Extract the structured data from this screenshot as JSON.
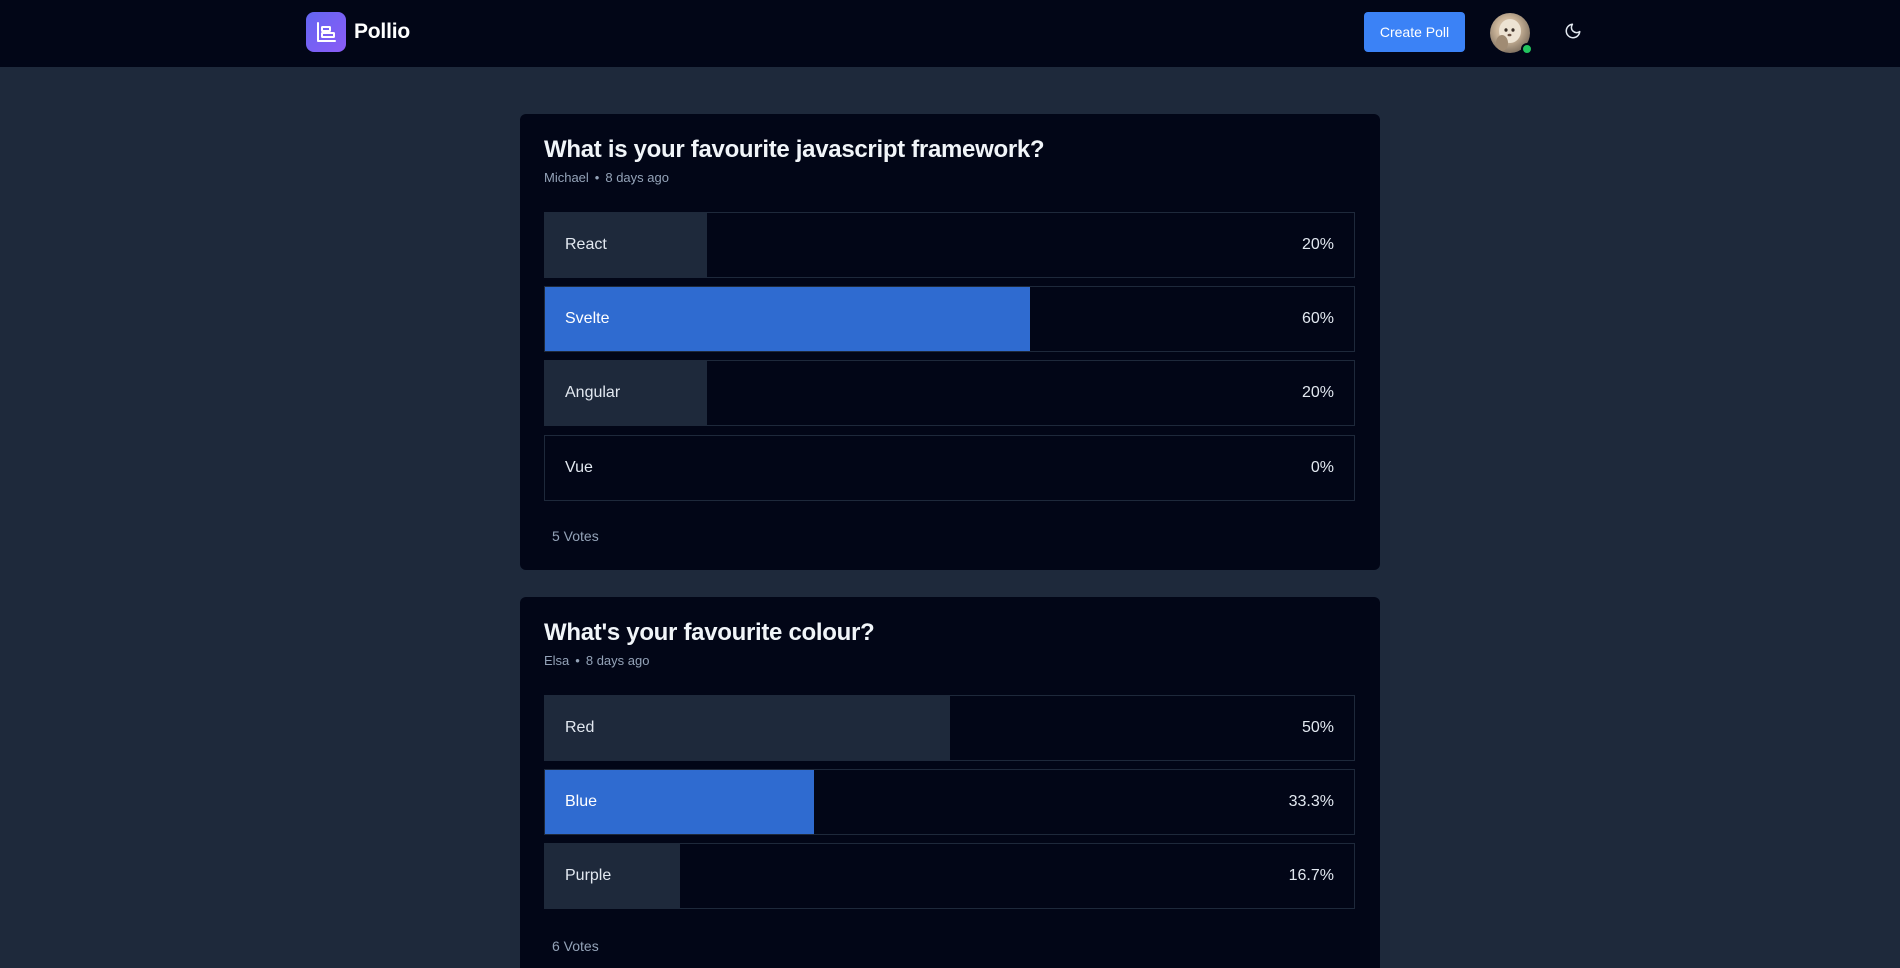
{
  "app": {
    "name": "Pollio",
    "logo_icon": "poll-chart-icon",
    "accent": "#3b82f6",
    "logo_gradient": [
      "#6366f1",
      "#8b5cf6"
    ]
  },
  "header": {
    "create_poll_label": "Create Poll",
    "avatar_status": "online",
    "theme_icon": "moon-icon"
  },
  "polls": [
    {
      "title": "What is your favourite javascript framework?",
      "author": "Michael",
      "separator": "•",
      "time_ago": "8 days ago",
      "options": [
        {
          "label": "React",
          "percent_text": "20%",
          "percent": 20,
          "selected": false
        },
        {
          "label": "Svelte",
          "percent_text": "60%",
          "percent": 60,
          "selected": true
        },
        {
          "label": "Angular",
          "percent_text": "20%",
          "percent": 20,
          "selected": false
        },
        {
          "label": "Vue",
          "percent_text": "0%",
          "percent": 0,
          "selected": false
        }
      ],
      "votes_text": "5 Votes"
    },
    {
      "title": "What's your favourite colour?",
      "author": "Elsa",
      "separator": "•",
      "time_ago": "8 days ago",
      "options": [
        {
          "label": "Red",
          "percent_text": "50%",
          "percent": 50,
          "selected": false
        },
        {
          "label": "Blue",
          "percent_text": "33.3%",
          "percent": 33.3,
          "selected": true
        },
        {
          "label": "Purple",
          "percent_text": "16.7%",
          "percent": 16.7,
          "selected": false
        }
      ],
      "votes_text": "6 Votes"
    }
  ]
}
